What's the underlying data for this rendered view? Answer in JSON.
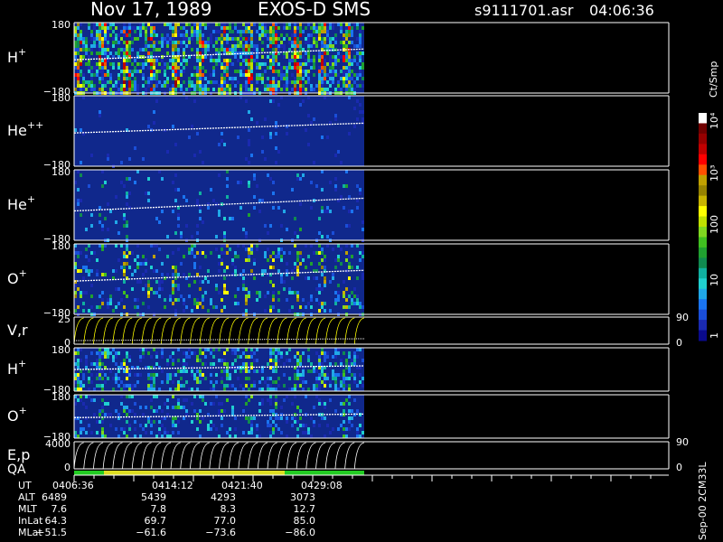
{
  "header": {
    "date": "Nov 17, 1989",
    "instrument": "EXOS-D SMS",
    "file": "s9111701.asr",
    "time": "04:06:36"
  },
  "colors": {
    "background": "#000000",
    "data_bg": "#10288c",
    "trace": "#ffffff",
    "velocity_trace": "#ffff00",
    "qa_good": "#22cc22",
    "qa_warn": "#dddd22"
  },
  "colorbar": {
    "unit": "Ct/Smp",
    "labels": [
      "1",
      "10",
      "100",
      "10³",
      "10⁴"
    ],
    "colors": [
      "#0a0a8c",
      "#1a2ab0",
      "#1a4ed8",
      "#1a74f0",
      "#20a8e8",
      "#20d0d0",
      "#10b0a0",
      "#108a50",
      "#20a030",
      "#40c020",
      "#80d820",
      "#c0e000",
      "#ffff00",
      "#c8b400",
      "#968200",
      "#c0a000",
      "#ff5000",
      "#ff0000",
      "#c00000",
      "#960000",
      "#700000",
      "#ffffff"
    ]
  },
  "right_axis": {
    "vr": {
      "top": "90",
      "bottom": "0"
    },
    "ep": {
      "top": "90",
      "bottom": "0"
    },
    "version": "Sep-00 2CM33L"
  },
  "time_axis": {
    "rows": [
      {
        "label": "UT",
        "values": [
          "0406:36",
          "0414:12",
          "0421:40",
          "0429:08"
        ]
      },
      {
        "label": "ALT",
        "values": [
          "6489",
          "5439",
          "4293",
          "3073"
        ]
      },
      {
        "label": "MLT",
        "values": [
          "7.6",
          "7.8",
          "8.3",
          "12.7"
        ]
      },
      {
        "label": "InLat",
        "values": [
          "64.3",
          "69.7",
          "77.0",
          "85.0"
        ]
      },
      {
        "label": "MLat",
        "values": [
          "−51.5",
          "−61.6",
          "−73.6",
          "−86.0"
        ]
      }
    ]
  },
  "chart_data": [
    {
      "type": "heatmap",
      "label": "H",
      "sup": "+",
      "y_top": "180",
      "y_bottom": "−180",
      "ylim": [
        -180,
        180
      ],
      "density": 0.85,
      "intensity": 0.62,
      "blank_gap": false,
      "pitch_trace": {
        "start": -10,
        "end": 45
      }
    },
    {
      "type": "heatmap",
      "label": "He",
      "sup": "++",
      "y_top": "180",
      "y_bottom": "−180",
      "ylim": [
        -180,
        180
      ],
      "density": 0.05,
      "intensity": 0.15,
      "blank_gap": false,
      "pitch_trace": {
        "start": -10,
        "end": 40
      }
    },
    {
      "type": "heatmap",
      "label": "He",
      "sup": "+",
      "y_top": "180",
      "y_bottom": "−180",
      "ylim": [
        -180,
        180
      ],
      "density": 0.12,
      "intensity": 0.28,
      "blank_gap": false,
      "pitch_trace": {
        "start": -30,
        "end": 35
      }
    },
    {
      "type": "heatmap",
      "label": "O",
      "sup": "+",
      "y_top": "180",
      "y_bottom": "−180",
      "ylim": [
        -180,
        180
      ],
      "density": 0.32,
      "intensity": 0.5,
      "blank_gap": false,
      "pitch_trace": {
        "start": -10,
        "end": 45
      }
    },
    {
      "type": "line",
      "label": "V,r",
      "sup": "",
      "y_top": "25",
      "y_bottom": "0",
      "ylim": [
        0,
        25
      ],
      "spin_cycles": 30
    },
    {
      "type": "heatmap",
      "label": "H",
      "sup": "+",
      "y_top": "180",
      "y_bottom": "−180",
      "ylim": [
        -180,
        180
      ],
      "density": 0.55,
      "intensity": 0.42,
      "blank_gap": false,
      "pitch_trace": {
        "start": 0,
        "end": 30
      }
    },
    {
      "type": "heatmap",
      "label": "O",
      "sup": "+",
      "y_top": "180",
      "y_bottom": "−180",
      "ylim": [
        -180,
        180
      ],
      "density": 0.3,
      "intensity": 0.33,
      "blank_gap": false,
      "pitch_trace": {
        "start": -10,
        "end": 20
      }
    },
    {
      "type": "line",
      "label": "E,p",
      "sup": "",
      "y_top": "4000",
      "y_bottom": "0",
      "ylim": [
        0,
        4000
      ],
      "spin_cycles": 30,
      "qa_label": "QA"
    }
  ]
}
